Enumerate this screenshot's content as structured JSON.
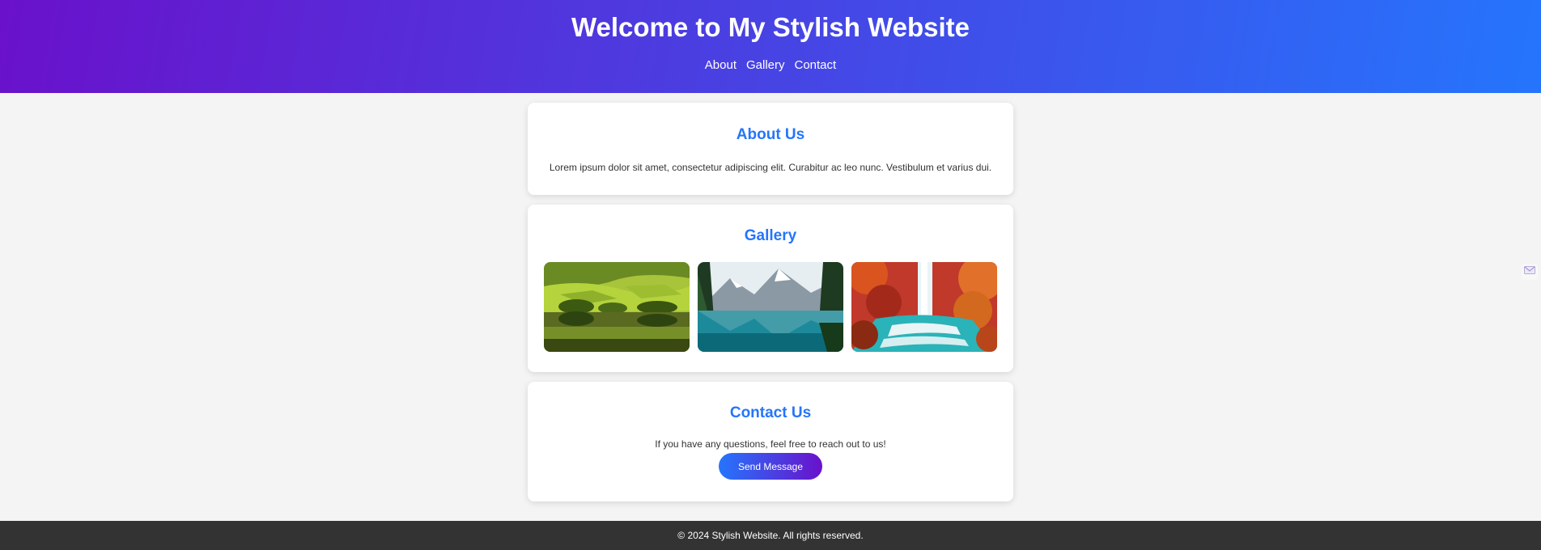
{
  "header": {
    "title": "Welcome to My Stylish Website",
    "nav": [
      "About",
      "Gallery",
      "Contact"
    ],
    "gradient_start": "#6a11cb",
    "gradient_end": "#2575fc"
  },
  "about": {
    "heading": "About Us",
    "text": "Lorem ipsum dolor sit amet, consectetur adipiscing elit. Curabitur ac leo nunc. Vestibulum et varius dui."
  },
  "gallery": {
    "heading": "Gallery",
    "images": [
      "green-hills-lake-image",
      "mountain-lake-image",
      "autumn-waterfall-image"
    ]
  },
  "contact": {
    "heading": "Contact Us",
    "text": "If you have any questions, feel free to reach out to us!",
    "button": "Send Message"
  },
  "footer": {
    "text": "© 2024 Stylish Website. All rights reserved."
  },
  "accent_color": "#2575fc",
  "side_widget_icon": "mail-icon"
}
